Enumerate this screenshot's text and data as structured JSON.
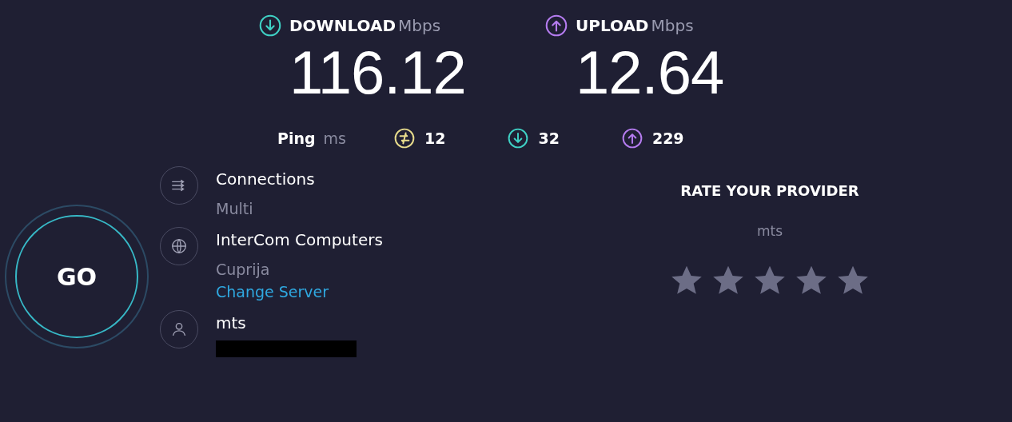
{
  "results": [
    {
      "kind": "download",
      "label": "DOWNLOAD",
      "unit": "Mbps",
      "value": "116.12"
    },
    {
      "kind": "upload",
      "label": "UPLOAD",
      "unit": "Mbps",
      "value": "12.64"
    }
  ],
  "ping": {
    "label": "Ping",
    "unit": "ms",
    "values": [
      {
        "kind": "idle",
        "value": "12"
      },
      {
        "kind": "download",
        "value": "32"
      },
      {
        "kind": "upload",
        "value": "229"
      }
    ]
  },
  "go_button": "GO",
  "details": [
    {
      "kind": "connections",
      "title": "Connections",
      "subtitle": "Multi"
    },
    {
      "kind": "server",
      "title": "InterCom Computers",
      "subtitle": "Cuprija",
      "link": "Change Server"
    },
    {
      "kind": "provider",
      "title": "mts",
      "redacted": true
    }
  ],
  "rating": {
    "title": "RATE YOUR PROVIDER",
    "provider": "mts"
  }
}
